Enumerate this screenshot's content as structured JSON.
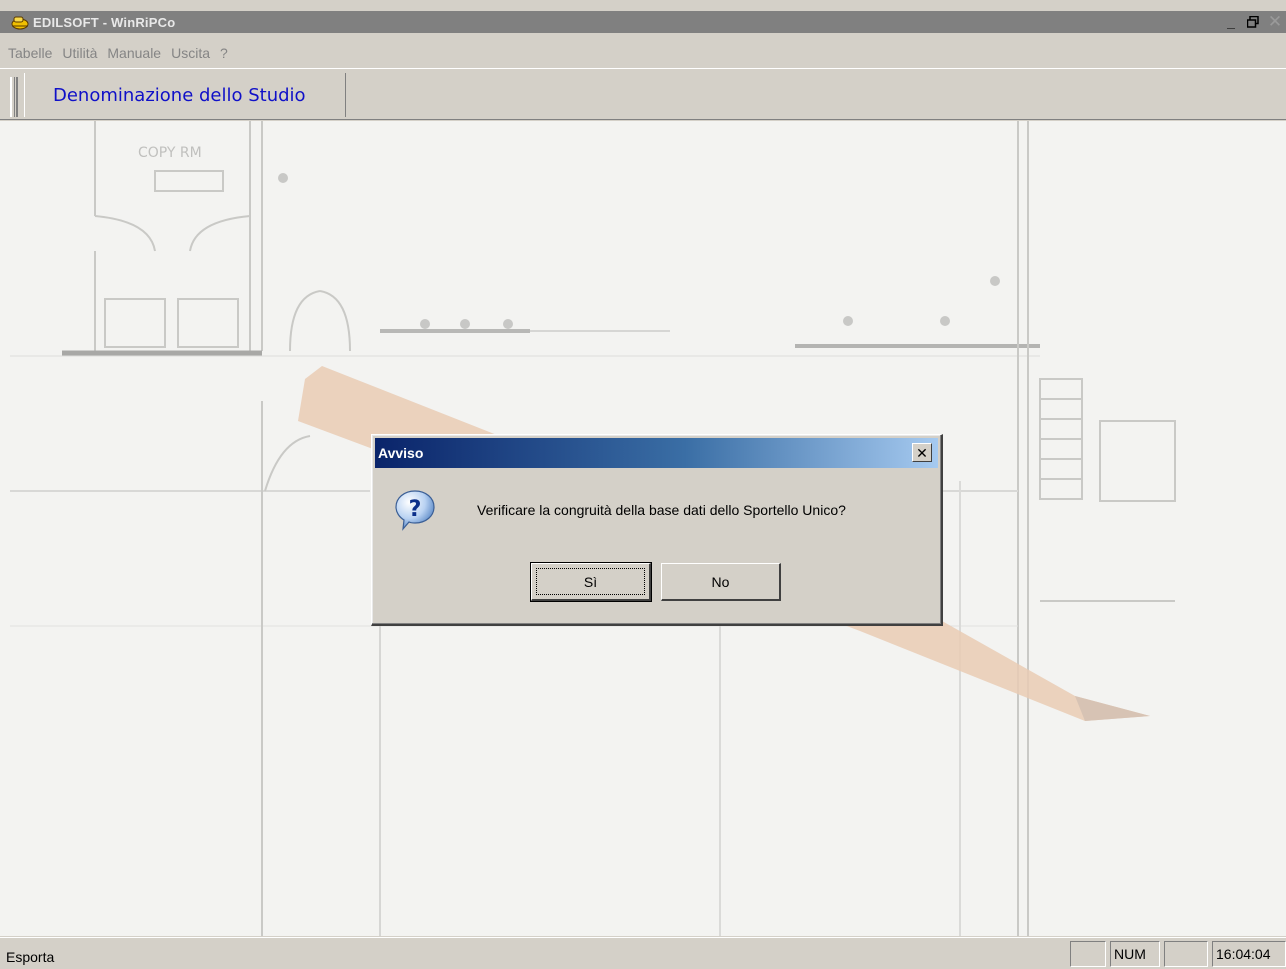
{
  "window": {
    "title": "EDILSOFT - WinRiPCo",
    "controls": {
      "minimize": "_",
      "restore": "🗗",
      "close": "✕"
    }
  },
  "menu": {
    "items": [
      "Tabelle",
      "Utilità",
      "Manuale",
      "Uscita",
      "?"
    ]
  },
  "toolbar": {
    "studio_label": "Denominazione dello Studio"
  },
  "dialog": {
    "title": "Avviso",
    "close_glyph": "✕",
    "icon": "question-icon",
    "message": "Verificare la congruità della base dati dello Sportello Unico?",
    "yes_label": "Sì",
    "no_label": "No"
  },
  "statusbar": {
    "text": "Esporta",
    "panels": [
      "",
      "NUM",
      "",
      "16:04:04"
    ]
  },
  "colors": {
    "dialog_title_start": "#0a246a",
    "dialog_title_end": "#a6caf0",
    "studio_label": "#1010c8",
    "chrome": "#d4d0c8"
  }
}
